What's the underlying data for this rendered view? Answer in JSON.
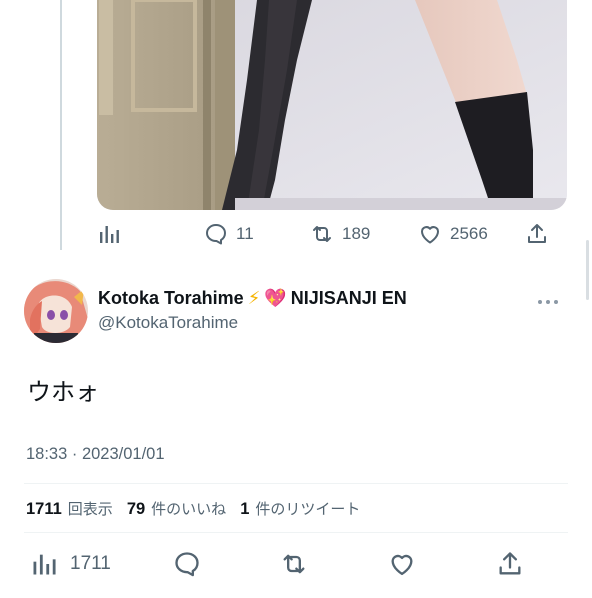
{
  "prev_tweet": {
    "image_alt": "photo",
    "actions": {
      "views_icon": "bar-chart-icon",
      "replies": "11",
      "retweets": "189",
      "likes": "2566",
      "share_icon": "share-icon"
    }
  },
  "tweet": {
    "author": {
      "name": "Kotoka Torahime",
      "badge_lightning": "⚡",
      "badge_heart": "💖",
      "affiliation": "NIJISANJI EN",
      "handle": "@KotokaTorahime"
    },
    "text": "ウホォ",
    "timestamp": "18:33 · 2023/01/01",
    "stats": {
      "views_count": "1711",
      "views_label": "回表示",
      "likes_count": "79",
      "likes_label": "件のいいね",
      "retweets_count": "1",
      "retweets_label": "件のリツイート"
    },
    "bottom_actions": {
      "views_count": "1711"
    }
  },
  "colors": {
    "text_primary": "#0f1419",
    "text_secondary": "#536471",
    "divider": "#eff3f4",
    "thread_line": "#cfd9de"
  }
}
